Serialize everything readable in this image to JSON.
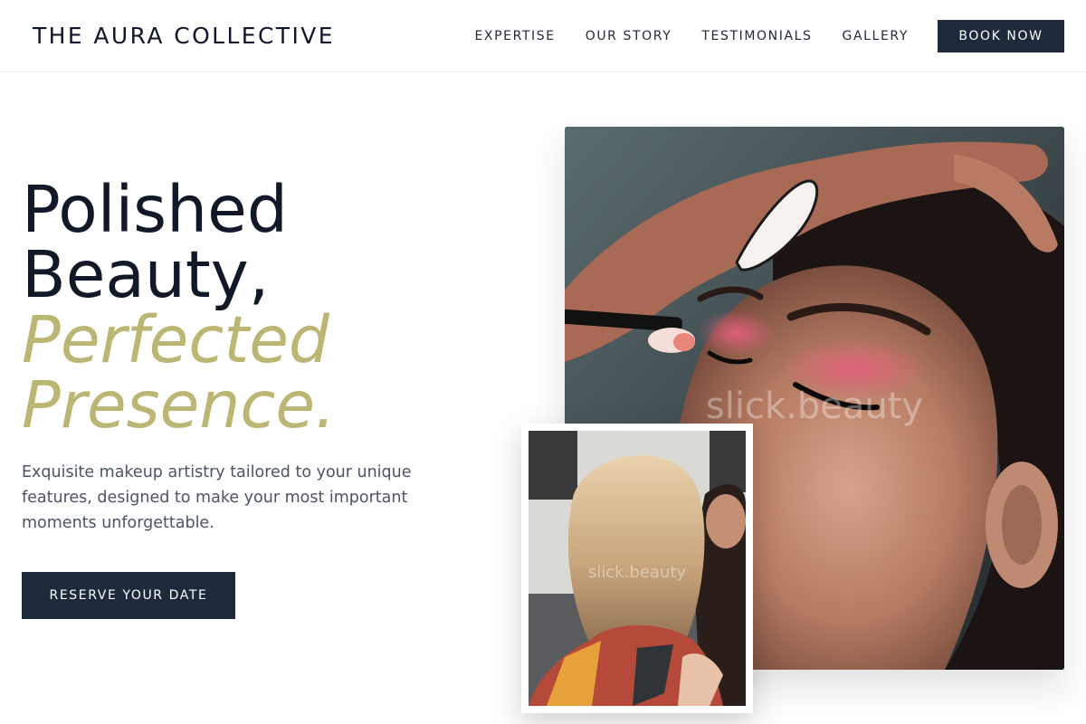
{
  "header": {
    "brand": "THE AURA COLLECTIVE",
    "nav": [
      "EXPERTISE",
      "OUR STORY",
      "TESTIMONIALS",
      "GALLERY"
    ],
    "book_label": "BOOK NOW"
  },
  "hero": {
    "line1": "Polished",
    "line2": "Beauty,",
    "accent1": "Perfected",
    "accent2": "Presence.",
    "lede": "Exquisite makeup artistry tailored to your unique features, designed to make your most important moments unforgettable.",
    "cta_label": "RESERVE YOUR DATE"
  },
  "images": {
    "main_watermark": "slick.beauty",
    "inset_watermark": "slick.beauty"
  },
  "colors": {
    "navy": "#1e293b",
    "accent": "#bcb674"
  }
}
